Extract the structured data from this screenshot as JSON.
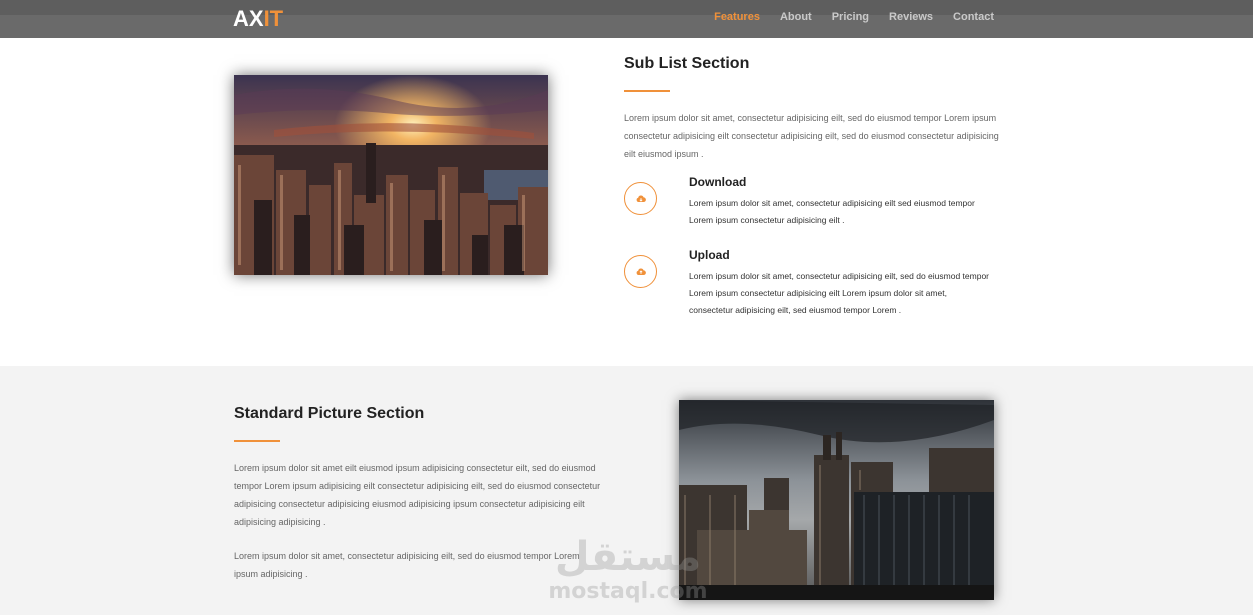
{
  "brand": {
    "logo_part1": "AX",
    "logo_part2": "IT",
    "accent": "#f0913a"
  },
  "nav": {
    "items": [
      {
        "label": "Features",
        "active": true
      },
      {
        "label": "About"
      },
      {
        "label": "Pricing"
      },
      {
        "label": "Reviews"
      },
      {
        "label": "Contact"
      }
    ]
  },
  "sub_list": {
    "title": "Sub List Section",
    "intro": "Lorem ipsum dolor sit amet, consectetur adipisicing eilt, sed do eiusmod tempor Lorem ipsum consectetur adipisicing eilt consectetur adipisicing eilt, sed do eiusmod consectetur adipisicing eilt eiusmod ipsum .",
    "items": [
      {
        "icon": "cloud-icon",
        "title": "Download",
        "text": "Lorem ipsum dolor sit amet, consectetur adipisicing eilt sed eiusmod tempor Lorem ipsum consectetur adipisicing eilt ."
      },
      {
        "icon": "cloud-icon",
        "title": "Upload",
        "text": "Lorem ipsum dolor sit amet, consectetur adipisicing eilt, sed do eiusmod tempor Lorem ipsum consectetur adipisicing eilt Lorem ipsum dolor sit amet, consectetur adipisicing eilt, sed eiusmod tempor Lorem ."
      }
    ]
  },
  "standard": {
    "title": "Standard Picture Section",
    "para1": "Lorem ipsum dolor sit amet eilt eiusmod ipsum adipisicing consectetur eilt, sed do eiusmod tempor Lorem ipsum adipisicing eilt consectetur adipisicing eilt, sed do eiusmod consectetur adipisicing consectetur adipisicing eiusmod adipisicing ipsum consectetur adipisicing eilt adipisicing adipisicing .",
    "para2": "Lorem ipsum dolor sit amet, consectetur adipisicing eilt, sed do eiusmod tempor Lorem ipsum adipisicing ."
  },
  "watermark": {
    "arabic": "مستقل",
    "latin": "mostaql.com"
  }
}
